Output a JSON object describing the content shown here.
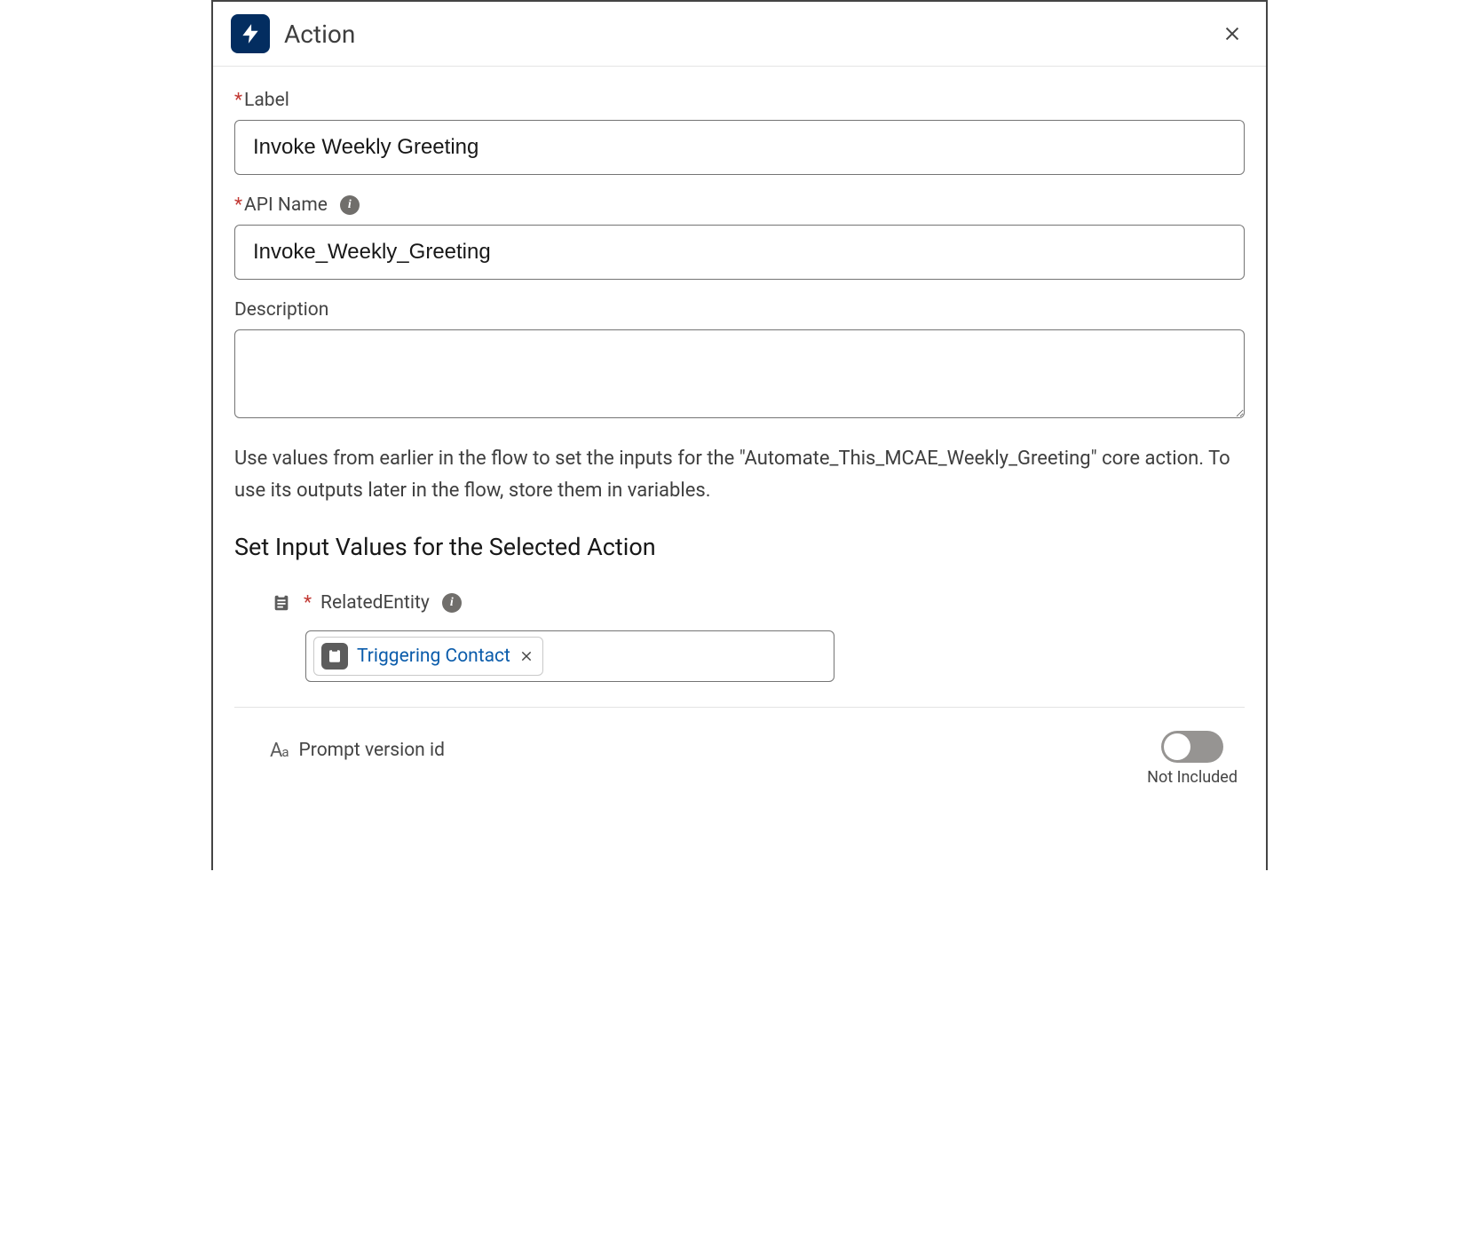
{
  "header": {
    "title": "Action"
  },
  "fields": {
    "label": {
      "label": "Label",
      "value": "Invoke Weekly Greeting",
      "required": true
    },
    "api_name": {
      "label": "API Name",
      "value": "Invoke_Weekly_Greeting",
      "required": true
    },
    "description": {
      "label": "Description",
      "value": ""
    }
  },
  "help_text": "Use values from earlier in the flow to set the inputs for the \"Automate_This_MCAE_Weekly_Greeting\" core action. To use its outputs later in the flow, store them in variables.",
  "section_title": "Set Input Values for the Selected Action",
  "inputs": {
    "related_entity": {
      "label": "RelatedEntity",
      "required": true,
      "pill_text": "Triggering Contact"
    },
    "prompt_version": {
      "label": "Prompt version id",
      "toggle_on": false,
      "toggle_caption": "Not Included"
    }
  }
}
